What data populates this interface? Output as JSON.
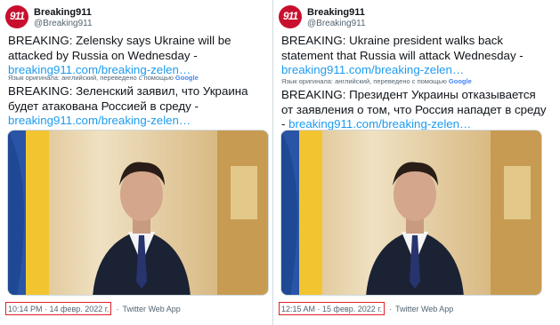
{
  "tweets": [
    {
      "avatar_text": "911",
      "name": "Breaking911",
      "handle": "@Breaking911",
      "original_text": "BREAKING: Zelensky says Ukraine will be attacked by Russia on Wednesday - ",
      "original_link": "breaking911.com/breaking-zelen…",
      "translation_note": "Язык оригинала: английский, переведено с помощью ",
      "translation_brand": "Google",
      "translated_text": "BREAKING: Зеленский заявил, что Украина будет атакована Россией в среду - ",
      "translated_link": "breaking911.com/breaking-zelen…",
      "timestamp": "10:14 PM · 14 февр. 2022 г.",
      "source": "Twitter Web App"
    },
    {
      "avatar_text": "911",
      "name": "Breaking911",
      "handle": "@Breaking911",
      "original_text": "BREAKING: Ukraine president walks back statement that Russia will attack Wednesday - ",
      "original_link": "breaking911.com/breaking-zelen…",
      "translation_note": "Язык оригинала: английский, переведено с помощью ",
      "translation_brand": "Google",
      "translated_text": "BREAKING: Президент Украины отказывается от заявления о том, что Россия нападет в среду - ",
      "translated_link": "breaking911.com/breaking-zelen…",
      "timestamp": "12:15 AM · 15 февр. 2022 г.",
      "source": "Twitter Web App"
    }
  ],
  "separator": "·",
  "colors": {
    "link": "#1d9bf0",
    "highlight_box": "#e0202a",
    "brand": "#c8102e"
  }
}
